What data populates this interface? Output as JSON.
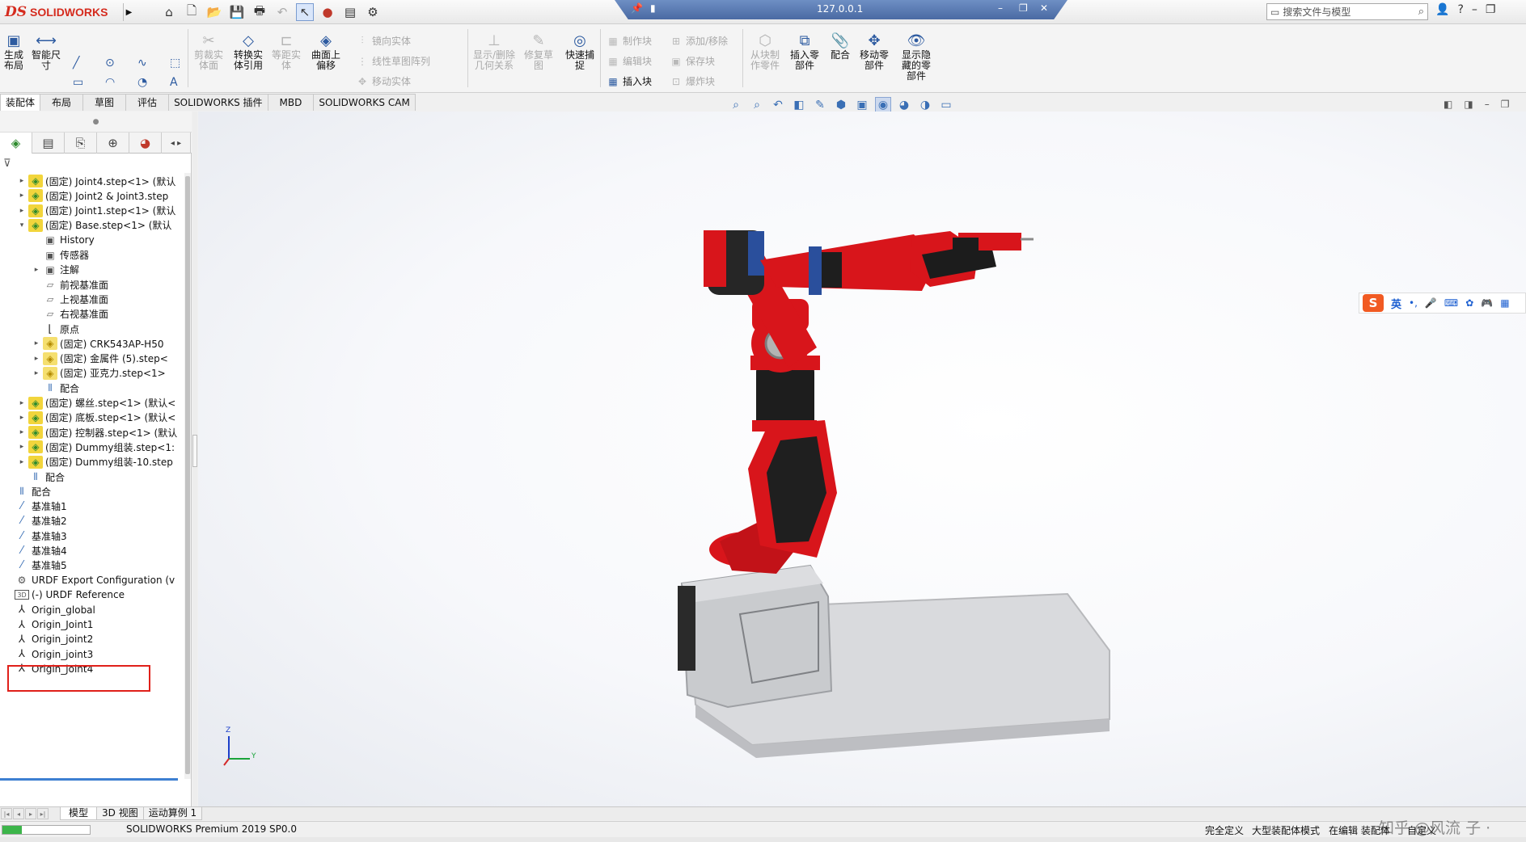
{
  "app": {
    "logo_ds": "DS",
    "logo_text": "SOLIDWORKS",
    "title": "127.0.0.1",
    "search_placeholder": "搜索文件与模型",
    "help": "?"
  },
  "ribbon": {
    "buttons": {
      "generate_layout": "生成\n布局",
      "smart_dim": "智能尺\n寸",
      "trim_entity": "剪裁实\n体面",
      "convert_entity": "转换实\n体引用",
      "equal_distance": "等距实\n体",
      "surface_offset": "曲面上\n偏移",
      "show_delete_relations": "显示/删除\n几何关系",
      "repair_sketch": "修复草\n图",
      "quick_snap": "快速捕\n捉",
      "from_block": "从块制\n作零件",
      "insert_part": "插入零\n部件",
      "mate": "配合",
      "move_part": "移动零\n部件",
      "show_hidden": "显示隐\n藏的零\n部件"
    },
    "small": {
      "mirror_entity": "镜向实体",
      "linear_pattern": "线性草图阵列",
      "move_entity": "移动实体",
      "make_block": "制作块",
      "edit_block": "编辑块",
      "insert_block": "插入块",
      "add_remove": "添加/移除",
      "save_block": "保存块",
      "explode_block": "爆炸块"
    }
  },
  "tabs": [
    "装配体",
    "布局",
    "草图",
    "评估",
    "SOLIDWORKS 插件",
    "MBD",
    "SOLIDWORKS CAM"
  ],
  "tree": [
    {
      "label": "(固定) Joint4.step<1> (默认",
      "icon": "asm",
      "indent": 0,
      "toggle": "▸"
    },
    {
      "label": "(固定) Joint2 & Joint3.step",
      "icon": "asm",
      "indent": 0,
      "toggle": "▸"
    },
    {
      "label": "(固定) Joint1.step<1> (默认",
      "icon": "asm",
      "indent": 0,
      "toggle": "▸"
    },
    {
      "label": "(固定) Base.step<1> (默认",
      "icon": "asm",
      "indent": 0,
      "toggle": "▾"
    },
    {
      "label": "History",
      "icon": "folder",
      "indent": 1,
      "toggle": ""
    },
    {
      "label": "传感器",
      "icon": "folder",
      "indent": 1,
      "toggle": ""
    },
    {
      "label": "注解",
      "icon": "folder",
      "indent": 1,
      "toggle": "▸"
    },
    {
      "label": "前视基准面",
      "icon": "plane",
      "indent": 1,
      "toggle": ""
    },
    {
      "label": "上视基准面",
      "icon": "plane",
      "indent": 1,
      "toggle": ""
    },
    {
      "label": "右视基准面",
      "icon": "plane",
      "indent": 1,
      "toggle": ""
    },
    {
      "label": "原点",
      "icon": "origin",
      "indent": 1,
      "toggle": ""
    },
    {
      "label": "(固定) CRK543AP-H50",
      "icon": "part",
      "indent": 1,
      "toggle": "▸"
    },
    {
      "label": "(固定) 金属件 (5).step<",
      "icon": "part",
      "indent": 1,
      "toggle": "▸"
    },
    {
      "label": "(固定) 亚克力.step<1>",
      "icon": "part",
      "indent": 1,
      "toggle": "▸"
    },
    {
      "label": "配合",
      "icon": "mate",
      "indent": 1,
      "toggle": ""
    },
    {
      "label": "(固定) 螺丝.step<1> (默认<",
      "icon": "asm",
      "indent": 0,
      "toggle": "▸"
    },
    {
      "label": "(固定) 底板.step<1> (默认<",
      "icon": "asm",
      "indent": 0,
      "toggle": "▸"
    },
    {
      "label": "(固定) 控制器.step<1> (默认",
      "icon": "asm",
      "indent": 0,
      "toggle": "▸"
    },
    {
      "label": "(固定) Dummy组装.step<1:",
      "icon": "asm",
      "indent": 0,
      "toggle": "▸"
    },
    {
      "label": "(固定) Dummy组装-10.step",
      "icon": "asm",
      "indent": 0,
      "toggle": "▸"
    },
    {
      "label": "配合",
      "icon": "mate",
      "indent": 0,
      "toggle": ""
    },
    {
      "label": "配合",
      "icon": "mate",
      "indent": -1,
      "toggle": ""
    },
    {
      "label": "基准轴1",
      "icon": "axis",
      "indent": -1,
      "toggle": ""
    },
    {
      "label": "基准轴2",
      "icon": "axis",
      "indent": -1,
      "toggle": ""
    },
    {
      "label": "基准轴3",
      "icon": "axis",
      "indent": -1,
      "toggle": ""
    },
    {
      "label": "基准轴4",
      "icon": "axis",
      "indent": -1,
      "toggle": ""
    },
    {
      "label": "基准轴5",
      "icon": "axis",
      "indent": -1,
      "toggle": ""
    },
    {
      "label": "URDF Export Configuration (v",
      "icon": "config",
      "indent": -1,
      "toggle": ""
    },
    {
      "label": "(-) URDF Reference",
      "icon": "3d",
      "indent": -1,
      "toggle": ""
    },
    {
      "label": "Origin_global",
      "icon": "coord",
      "indent": -1,
      "toggle": ""
    },
    {
      "label": "Origin_Joint1",
      "icon": "coord",
      "indent": -1,
      "toggle": ""
    },
    {
      "label": "Origin_joint2",
      "icon": "coord",
      "indent": -1,
      "toggle": ""
    },
    {
      "label": "Origin_joint3",
      "icon": "coord",
      "indent": -1,
      "toggle": ""
    },
    {
      "label": "Origin_joint4",
      "icon": "coord",
      "indent": -1,
      "toggle": ""
    }
  ],
  "bottom_tabs": [
    "模型",
    "3D 视图",
    "运动算例 1"
  ],
  "status": {
    "version": "SOLIDWORKS Premium 2019 SP0.0",
    "fully_defined": "完全定义",
    "large_assembly": "大型装配体模式",
    "editing_assembly": "在编辑 装配体",
    "custom": "自定义",
    "progress": 0.22
  },
  "ime": {
    "logo": "S",
    "lang": "英"
  },
  "triad": {
    "z": "Z",
    "y": "Y"
  },
  "watermark": "知乎 @风流 子 · David",
  "colors": {
    "brand": "#d52b1e",
    "highlight": "#e0201a",
    "arm": "#d8151b"
  }
}
